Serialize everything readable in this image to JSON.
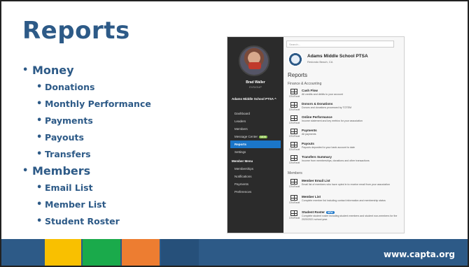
{
  "slide": {
    "title": "Reports",
    "bullets": [
      {
        "label": "Money",
        "children": [
          "Donations",
          "Monthly Performance",
          "Payments",
          "Payouts",
          "Transfers"
        ]
      },
      {
        "label": "Members",
        "children": [
          "Email List",
          "Member List",
          "Student Roster"
        ]
      }
    ],
    "footer_url": "www.capta.org",
    "colors": {
      "title": "#2d5a87",
      "bar": "#2d5a87",
      "yellow": "#f9c000",
      "green": "#1aaa4b",
      "orange": "#ed7d31"
    }
  },
  "app": {
    "search_placeholder": "Search...",
    "user": {
      "name": "Brad Waller",
      "role": "EVS/OUP"
    },
    "school": "Adams Middle School PTSA ^",
    "nav": [
      "Dashboard",
      "Leaders",
      "Members",
      "Message Center",
      "Reports",
      "Settings"
    ],
    "nav_badge": "NEW",
    "member_menu_label": "Member Menu",
    "member_menu": [
      "Memberships",
      "Notifications",
      "Payments",
      "Preferences"
    ],
    "org_name": "Adams Middle School PTSA",
    "org_location": "Redondo Beach, CA",
    "page_title": "Reports",
    "section_finance": "Finance & Accounting",
    "section_members": "Members",
    "icon_label": "CSV/Excel",
    "finance_reports": [
      {
        "title": "Cash Flow",
        "desc": "All credits and debits to your account"
      },
      {
        "title": "Donors & Donations",
        "desc": "Donors and donations processed by TOTEM"
      },
      {
        "title": "Online Performance",
        "desc": "Income statement and key metrics for your association"
      },
      {
        "title": "Payments",
        "desc": "All payments"
      },
      {
        "title": "Payouts",
        "desc": "Payouts deposited to your bank account to date"
      },
      {
        "title": "Transfers Summary",
        "desc": "Income from memberships, donations and other transactions"
      }
    ],
    "member_reports": [
      {
        "title": "Member Email List",
        "desc": "Email list of members who have opted in to receive email from your association"
      },
      {
        "title": "Member List",
        "desc": "Complete member list including contact information and membership status"
      },
      {
        "title": "Student Roster",
        "desc": "Complete student roster including student members and student non-members for the 2020/2021 school year.",
        "badge": "NEW"
      }
    ]
  }
}
